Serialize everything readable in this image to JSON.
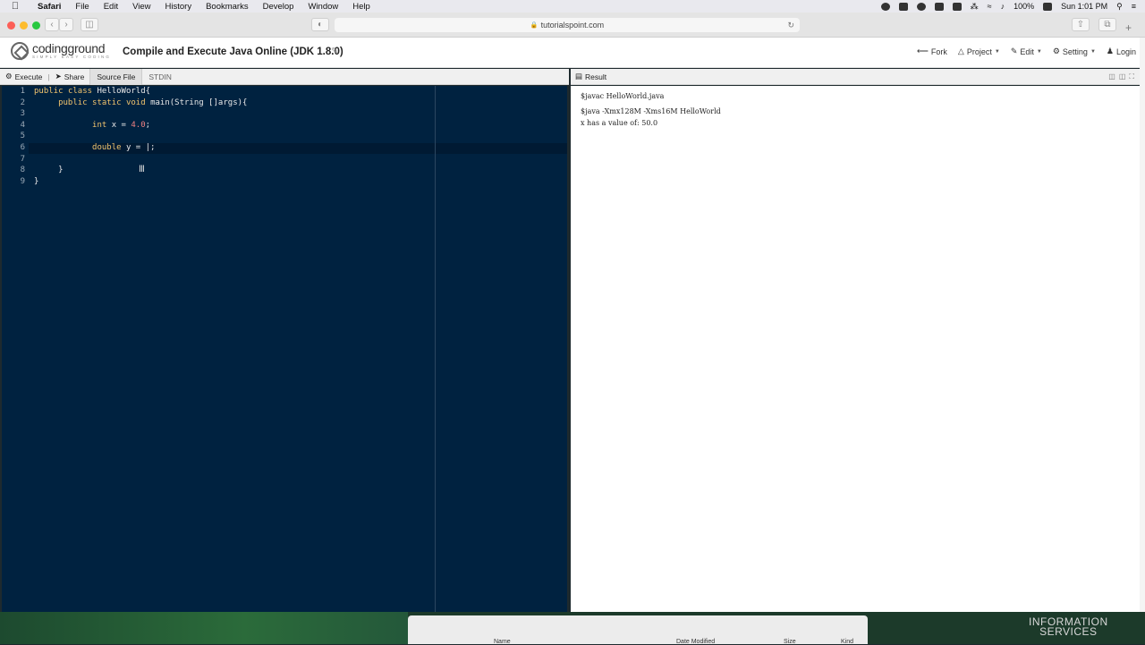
{
  "menubar": {
    "app": "Safari",
    "items": [
      "File",
      "Edit",
      "View",
      "History",
      "Bookmarks",
      "Develop",
      "Window",
      "Help"
    ],
    "battery": "100%",
    "clock": "Sun 1:01 PM"
  },
  "browser": {
    "url": "tutorialspoint.com"
  },
  "site": {
    "logo_main": "codingground",
    "logo_tag": "SIMPLY EASY CODING",
    "title": "Compile and Execute Java Online (JDK 1.8.0)",
    "nav": {
      "fork": "Fork",
      "project": "Project",
      "edit": "Edit",
      "setting": "Setting",
      "login": "Login"
    }
  },
  "editor": {
    "execute": "Execute",
    "share": "Share",
    "tab_source": "Source File",
    "tab_stdin": "STDIN",
    "line_numbers": [
      "1",
      "2",
      "3",
      "4",
      "5",
      "6",
      "7",
      "8",
      "9"
    ],
    "lines": [
      "public class HelloWorld{",
      "     public static void main(String []args){",
      "",
      "            int x = 4.0;",
      "",
      "            double y = |;",
      "",
      "     }",
      "}"
    ]
  },
  "result": {
    "title": "Result",
    "lines": [
      "$javac HelloWorld.java",
      "$java -Xmx128M -Xms16M HelloWorld",
      "x has a value of: 50.0"
    ]
  },
  "finder": {
    "col_name": "Name",
    "col_date": "Date Modified",
    "col_size": "Size",
    "col_kind": "Kind"
  },
  "desktop": {
    "brand_line1": "INFORMATION",
    "brand_line2": "SERVICES"
  }
}
